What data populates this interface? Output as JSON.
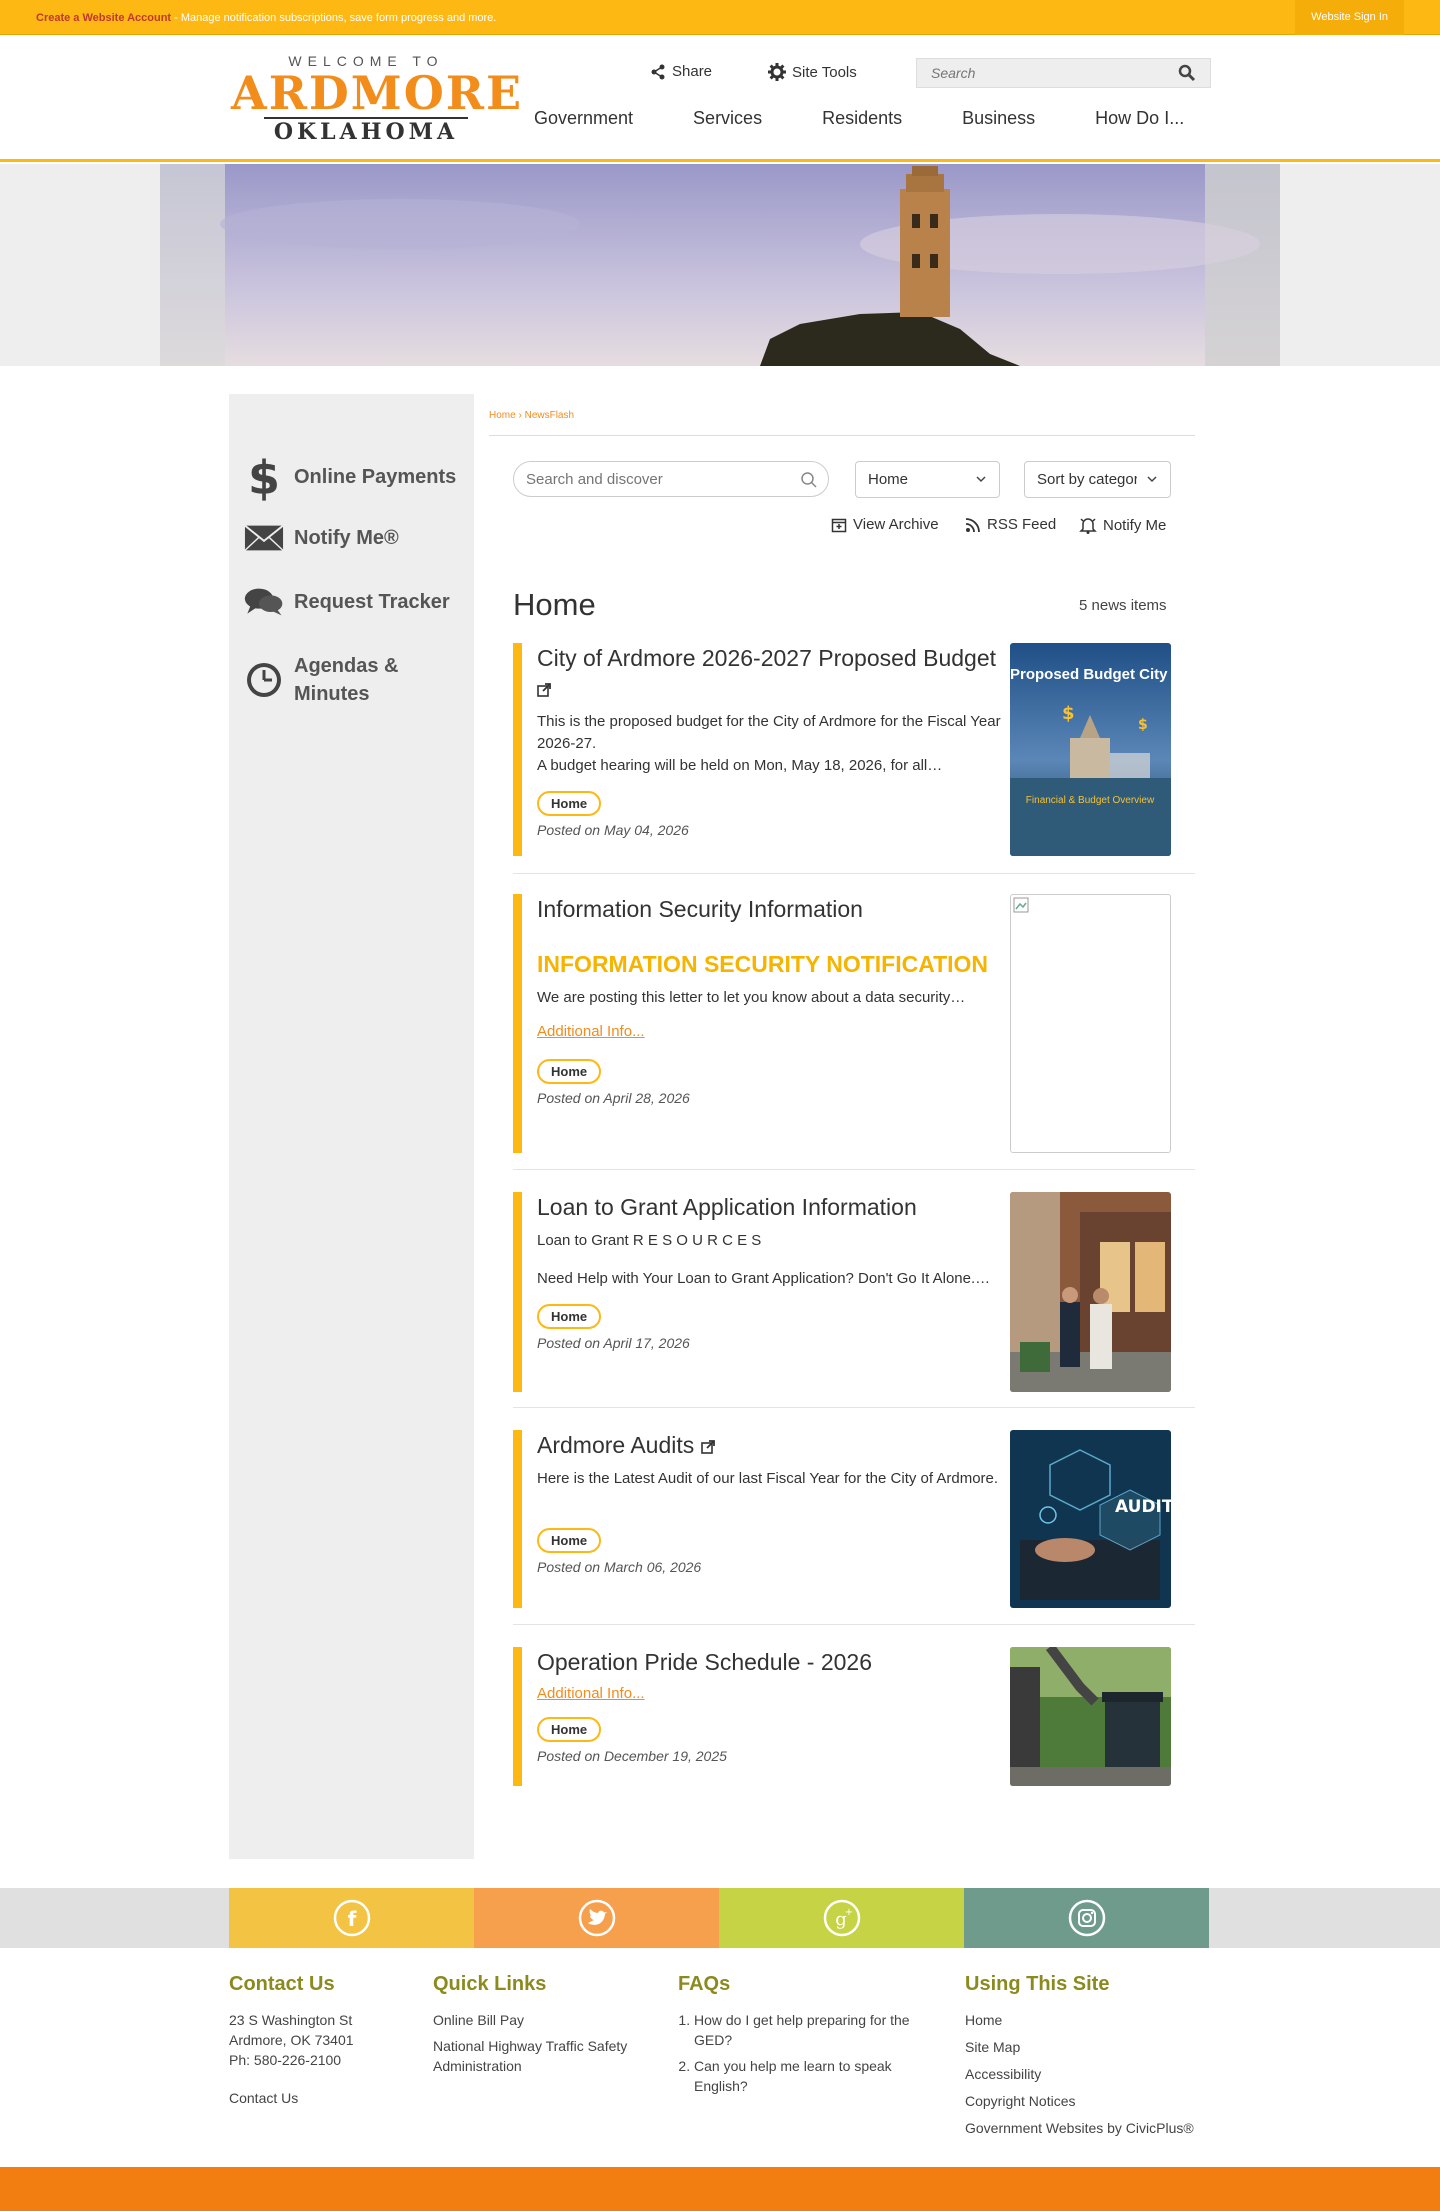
{
  "topbar": {
    "create_link": "Create a Website Account",
    "create_message": " - Manage notification subscriptions, save form progress and more.",
    "sign_in": "Website Sign In"
  },
  "header": {
    "logo_welcome": "WELCOME TO",
    "logo_name": "ARDMORE",
    "logo_state": "OKLAHOMA",
    "share": "Share",
    "site_tools": "Site Tools",
    "search_placeholder": "Search",
    "nav": [
      "Government",
      "Services",
      "Residents",
      "Business",
      "How Do I..."
    ]
  },
  "sidebar": {
    "items": [
      {
        "label": "Online Payments",
        "icon": "dollar-icon"
      },
      {
        "label": "Notify Me®",
        "icon": "envelope-icon"
      },
      {
        "label": "Request Tracker",
        "icon": "chat-bubbles-icon"
      },
      {
        "label": "Agendas & Minutes",
        "icon": "clock-icon"
      }
    ]
  },
  "breadcrumb": {
    "home": "Home",
    "separator": "›",
    "current": "NewsFlash"
  },
  "filters": {
    "search_placeholder": "Search and discover",
    "category": "Home",
    "sort": "Sort by category"
  },
  "actions": {
    "archive": "View Archive",
    "rss": "RSS Feed",
    "notify": "Notify Me"
  },
  "feed": {
    "title": "Home",
    "count": "5 news items",
    "items": [
      {
        "title": "City of Ardmore 2026-2027 Proposed Budget",
        "desc1": "This is the proposed budget for the City of Ardmore for the Fiscal Year 2026-27.",
        "desc2": "A budget hearing will be held on Mon, May 18, 2026, for all…",
        "tag": "Home",
        "posted": "Posted on May 04, 2026",
        "thumb_title": "Proposed Budget City of",
        "thumb_caption": "Financial & Budget Overview"
      },
      {
        "title": "Information Security Information",
        "heading": "INFORMATION SECURITY NOTIFICATION",
        "desc1": "We are posting this letter to let you know about a data security…",
        "link": "Additional Info...",
        "tag": "Home",
        "posted": "Posted on April 28, 2026"
      },
      {
        "title": "Loan to Grant Application Information",
        "desc1": "Loan to Grant R E S O U R C E S",
        "desc2": "Need Help with Your Loan to Grant Application? Don't Go It Alone.…",
        "tag": "Home",
        "posted": "Posted on April 17, 2026"
      },
      {
        "title": "Ardmore Audits",
        "desc1": "Here is the Latest Audit of our last Fiscal Year for the City of Ardmore.",
        "tag": "Home",
        "posted": "Posted on March 06, 2026",
        "thumb_text": "AUDIT"
      },
      {
        "title": "Operation Pride Schedule - 2026",
        "link": "Additional Info...",
        "tag": "Home",
        "posted": "Posted on December 19, 2025"
      }
    ]
  },
  "social": [
    {
      "icon": "facebook-icon",
      "color": "#f3c343",
      "glyph": "f"
    },
    {
      "icon": "twitter-icon",
      "color": "#f6a04d",
      "glyph": "t"
    },
    {
      "icon": "google-plus-icon",
      "color": "#c6d344",
      "glyph": "g+"
    },
    {
      "icon": "instagram-icon",
      "color": "#6e9b8b",
      "glyph": "ig"
    }
  ],
  "footer": {
    "contact": {
      "heading": "Contact Us",
      "address1": "23 S Washington St",
      "address2": "Ardmore, OK 73401",
      "phone": "Ph: 580-226-2100",
      "link": "Contact Us"
    },
    "quick_links": {
      "heading": "Quick Links",
      "items": [
        "Online Bill Pay",
        "National Highway Traffic Safety Administration"
      ]
    },
    "faqs": {
      "heading": "FAQs",
      "items": [
        "How do I get help preparing for the GED?",
        "Can you help me learn to speak English?"
      ]
    },
    "using_site": {
      "heading": "Using This Site",
      "items": [
        "Home",
        "Site Map",
        "Accessibility",
        "Copyright Notices",
        "Government Websites by CivicPlus®"
      ]
    }
  },
  "colors": {
    "accent": "#fdb814",
    "brand_orange": "#f28c1b",
    "footer_heading": "#8a8a1e"
  }
}
